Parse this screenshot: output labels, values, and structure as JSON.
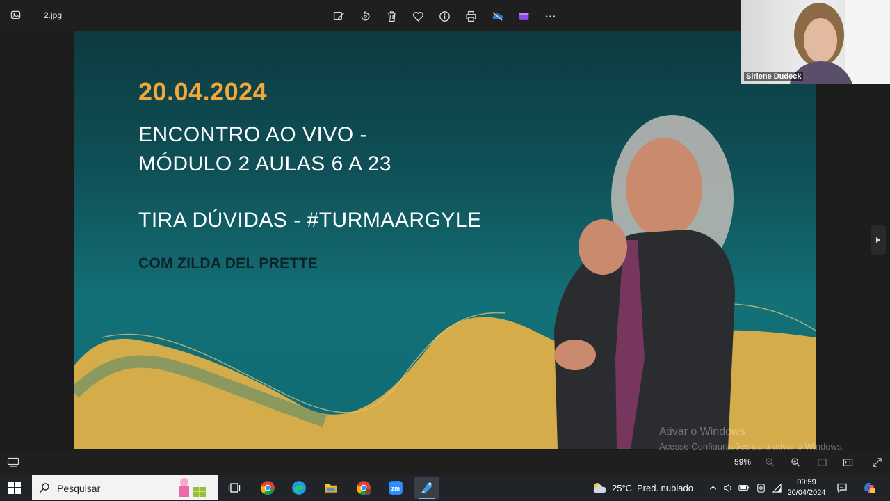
{
  "titlebar": {
    "filename": "2.jpg",
    "toolbar": [
      "edit-icon",
      "rotate-icon",
      "delete-icon",
      "favorite-icon",
      "info-icon",
      "print-icon",
      "onedrive-icon",
      "clipchamp-icon",
      "more-icon"
    ]
  },
  "slide": {
    "date": "20.04.2024",
    "line1": "ENCONTRO AO VIVO -",
    "line2": "MÓDULO 2  AULAS 6 A 23",
    "line3": "TIRA DÚVIDAS - #TURMAARGYLE",
    "line4": "COM ZILDA DEL PRETTE",
    "colors": {
      "date": "#f2a73a",
      "wave": "#d4ac4a",
      "background": "#106068"
    }
  },
  "watermark": {
    "title": "Ativar o Windows",
    "subtitle": "Acesse Configurações para ativar o Windows."
  },
  "webcam": {
    "name": "Sirlene Dudeck"
  },
  "statusbar": {
    "zoom": "59%"
  },
  "taskbar": {
    "search_placeholder": "Pesquisar",
    "weather_temp": "25°C",
    "weather_desc": "Pred. nublado",
    "time": "09:59",
    "date": "20/04/2024"
  }
}
